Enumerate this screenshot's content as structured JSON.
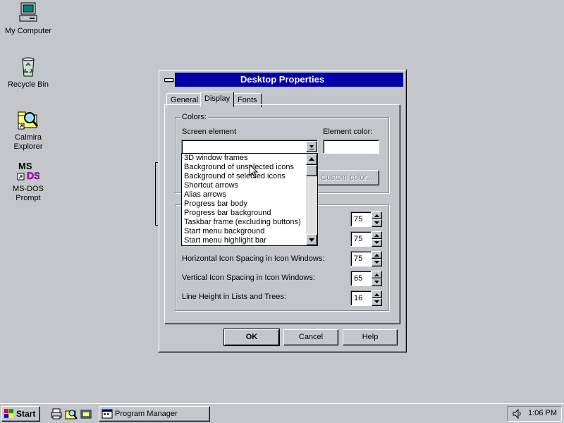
{
  "desktop": {
    "icons": [
      {
        "label": "My Computer",
        "icon": "computer-icon"
      },
      {
        "label": "Recycle Bin",
        "icon": "recycle-bin-icon"
      },
      {
        "label_line1": "Calmira",
        "label_line2": "Explorer",
        "icon": "explorer-icon"
      },
      {
        "label_line1": "MS-DOS",
        "label_line2": "Prompt",
        "icon": "msdos-icon"
      }
    ]
  },
  "dialog": {
    "title": "Desktop Properties",
    "tabs": [
      "General",
      "Display",
      "Fonts"
    ],
    "active_tab": "Display",
    "colors_group": {
      "legend": "Colors:",
      "screen_element_label": "Screen element",
      "screen_element_value": "",
      "element_color_label": "Element color:",
      "custom_color_button": "Custom color..."
    },
    "screen_element_options": [
      "3D window frames",
      "Background of unselected icons",
      "Background of selected icons",
      "Shortcut arrows",
      "Alias arrows",
      "Progress bar body",
      "Progress bar background",
      "Taskbar frame (excluding buttons)",
      "Start menu background",
      "Start menu highlight bar"
    ],
    "spacing": [
      {
        "label": "",
        "value": "75"
      },
      {
        "label": "",
        "value": "75"
      },
      {
        "label": "Horizontal Icon Spacing in Icon Windows:",
        "value": "75"
      },
      {
        "label": "Vertical Icon Spacing in Icon Windows:",
        "value": "65"
      },
      {
        "label": "Line Height in Lists and Trees:",
        "value": "16"
      }
    ],
    "buttons": {
      "ok": "OK",
      "cancel": "Cancel",
      "help": "Help"
    }
  },
  "taskbar": {
    "start_label": "Start",
    "task_button": "Program Manager",
    "clock": "1:06 PM",
    "quick_launch": [
      "printer-icon",
      "search-icon",
      "folder-icon"
    ]
  },
  "colors": {
    "desktop": "#c3c7cb",
    "titlebar": "#0000a8",
    "face": "#c3c7cb",
    "shadow": "#86898c"
  }
}
